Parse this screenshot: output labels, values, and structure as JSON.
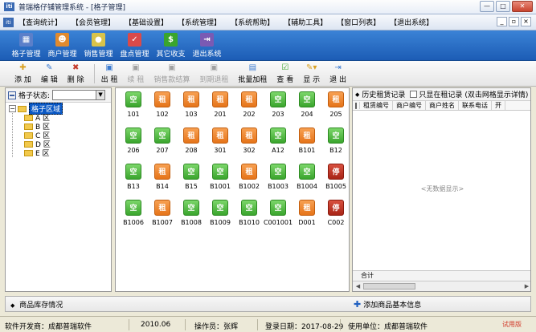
{
  "window": {
    "title": "普瑞格仔铺管理系统 - [格子管理]",
    "app_icon_text": "iti"
  },
  "menubar": {
    "icon_text": "iti",
    "items": [
      "【查询统计】",
      "【会员管理】",
      "【基础设置】",
      "【系统管理】",
      "【系统帮助】",
      "【辅助工具】",
      "【窗口列表】",
      "【退出系统】"
    ]
  },
  "bigtoolbar": [
    {
      "label": "格子管理",
      "icon": "grid-icon",
      "color": "#5b7fc9"
    },
    {
      "label": "商户管理",
      "icon": "people-icon",
      "color": "#e08a2e"
    },
    {
      "label": "销售管理",
      "icon": "coins-icon",
      "color": "#d9c34a"
    },
    {
      "label": "盘点管理",
      "icon": "clipboard-icon",
      "color": "#d94a4a"
    },
    {
      "label": "其它收支",
      "icon": "money-icon",
      "color": "#3aa52d"
    },
    {
      "label": "退出系统",
      "icon": "exit-icon",
      "color": "#7a5ab3"
    }
  ],
  "subtoolbar": [
    {
      "label": "添 加",
      "icon": "add-icon",
      "enabled": true
    },
    {
      "label": "编 辑",
      "icon": "edit-icon",
      "enabled": true
    },
    {
      "label": "删 除",
      "icon": "delete-icon",
      "enabled": true
    },
    {
      "label": "出 租",
      "icon": "rent-icon",
      "enabled": true
    },
    {
      "label": "续 租",
      "icon": "renew-icon",
      "enabled": false
    },
    {
      "label": "销售款结算",
      "icon": "settle-icon",
      "enabled": false
    },
    {
      "label": "到期退租",
      "icon": "return-icon",
      "enabled": false
    },
    {
      "label": "批量加租",
      "icon": "batch-icon",
      "enabled": true
    },
    {
      "label": "查 看",
      "icon": "view-icon",
      "enabled": true
    },
    {
      "label": "显 示",
      "icon": "display-icon",
      "enabled": true
    },
    {
      "label": "退 出",
      "icon": "exit-icon",
      "enabled": true
    }
  ],
  "left": {
    "status_label": "格子状态:",
    "tree_root": "格子区域",
    "tree_children": [
      "A 区",
      "B 区",
      "C 区",
      "D 区",
      "E 区"
    ]
  },
  "grid": {
    "status_text": {
      "empty": "空",
      "rented": "租",
      "stopped": "停"
    },
    "cells": [
      {
        "id": "101",
        "status": "empty"
      },
      {
        "id": "102",
        "status": "rented"
      },
      {
        "id": "103",
        "status": "rented"
      },
      {
        "id": "201",
        "status": "rented"
      },
      {
        "id": "202",
        "status": "rented"
      },
      {
        "id": "203",
        "status": "empty"
      },
      {
        "id": "204",
        "status": "empty"
      },
      {
        "id": "205",
        "status": "rented"
      },
      {
        "id": "206",
        "status": "empty"
      },
      {
        "id": "207",
        "status": "empty"
      },
      {
        "id": "208",
        "status": "rented"
      },
      {
        "id": "301",
        "status": "rented"
      },
      {
        "id": "302",
        "status": "rented"
      },
      {
        "id": "A12",
        "status": "empty"
      },
      {
        "id": "B101",
        "status": "rented"
      },
      {
        "id": "B12",
        "status": "empty"
      },
      {
        "id": "B13",
        "status": "empty"
      },
      {
        "id": "B14",
        "status": "rented"
      },
      {
        "id": "B15",
        "status": "empty"
      },
      {
        "id": "B1001",
        "status": "empty"
      },
      {
        "id": "B1002",
        "status": "rented"
      },
      {
        "id": "B1003",
        "status": "empty"
      },
      {
        "id": "B1004",
        "status": "empty"
      },
      {
        "id": "B1005",
        "status": "stopped"
      },
      {
        "id": "B1006",
        "status": "empty"
      },
      {
        "id": "B1007",
        "status": "rented"
      },
      {
        "id": "B1008",
        "status": "empty"
      },
      {
        "id": "B1009",
        "status": "empty"
      },
      {
        "id": "B1010",
        "status": "empty"
      },
      {
        "id": "C001001",
        "status": "empty"
      },
      {
        "id": "D001",
        "status": "rented"
      },
      {
        "id": "C002",
        "status": "stopped"
      }
    ]
  },
  "right": {
    "title": "历史租赁记录",
    "checkbox_label": "只显在租记录",
    "hint": "(双击网格显示详情)",
    "columns": [
      "租赁编号",
      "商户编号",
      "商户姓名",
      "联系电话",
      "开"
    ],
    "empty_text": "<无数据显示>",
    "total_label": "合计"
  },
  "bottom": {
    "left_title": "商品库存情况",
    "right_title": "添加商品基本信息"
  },
  "statusbar": {
    "developer": "软件开发商：成都普瑞软件",
    "version": "2010.06",
    "operator": "操作员：张辉",
    "login_date": "登录日期：2017-08-29",
    "unit": "使用单位：成都普瑞软件",
    "watermark": "试用版"
  }
}
